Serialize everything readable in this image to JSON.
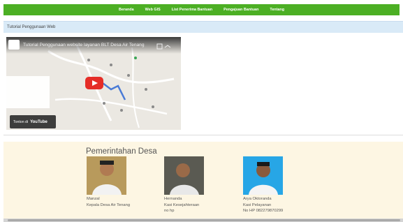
{
  "nav": {
    "items": [
      "Beranda",
      "Web GIS",
      "List Penerima Bantuan",
      "Pengajuan Bantuan",
      "Tentang"
    ]
  },
  "section": {
    "title": "Tutorial Penggunaan Web"
  },
  "video": {
    "title": "Tutorial Penggunaan website layanan BLT Desa Air Tenang",
    "watch_on": "Tonton di",
    "platform": "YouTube"
  },
  "government": {
    "title": "Pemerintahan Desa",
    "members": [
      {
        "name": "Manzal",
        "position": "Kepala Desa Air Tenang",
        "phone": ""
      },
      {
        "name": "Hernanda",
        "position": "Kasi Kesejahteraan",
        "phone": "no hp"
      },
      {
        "name": "Arya Oktoranda",
        "position": "Kasi Pelayanan",
        "phone": "No HP 082279870299"
      }
    ]
  },
  "colors": {
    "nav_bg": "#4caf24",
    "section_bg": "#d9eaf7",
    "gov_bg": "#fdf6e3",
    "play": "#e52d27"
  }
}
